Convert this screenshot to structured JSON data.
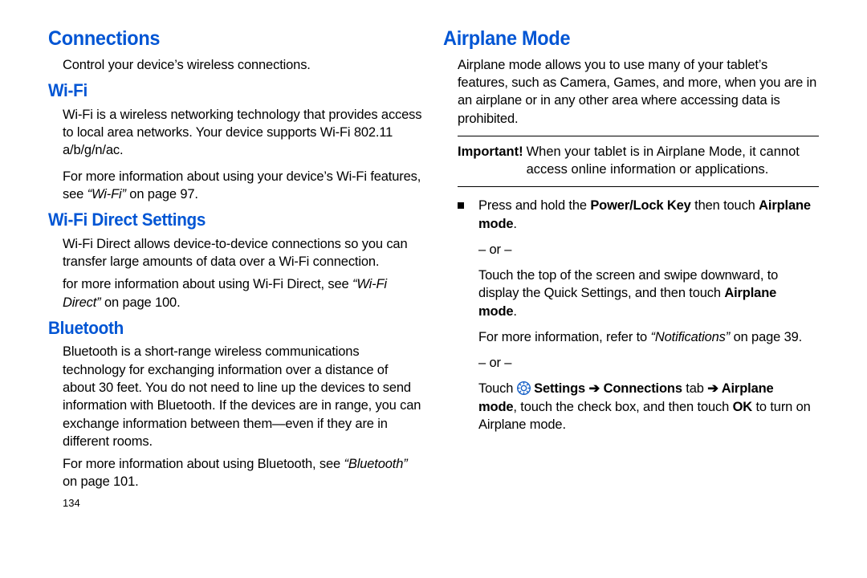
{
  "left": {
    "h1": "Connections",
    "intro": "Control your device’s wireless connections.",
    "wifi_h": "Wi-Fi",
    "wifi_p1a": "Wi-Fi is a wireless networking technology that provides access to local area networks. Your device supports Wi-Fi 802.11 a/b/g/n/ac.",
    "wifi_p2a": "For more information about using your device’s Wi-Fi features, see ",
    "wifi_p2i": "“Wi-Fi”",
    "wifi_p2b": " on page 97.",
    "wfd_h": "Wi-Fi Direct Settings",
    "wfd_p1": "Wi-Fi Direct allows device-to-device connections so you can transfer large amounts of data over a Wi-Fi connection.",
    "wfd_p2a": "for more information about using Wi-Fi Direct, see ",
    "wfd_p2i": "“Wi-Fi Direct”",
    "wfd_p2b": " on page 100.",
    "bt_h": "Bluetooth",
    "bt_p1": "Bluetooth is a short-range wireless communications technology for exchanging information over a distance of about 30 feet. You do not need to line up the devices to send information with Bluetooth. If the devices are in range, you can exchange information between them—even if they are in different rooms.",
    "bt_p2a": "For more information about using Bluetooth, see ",
    "bt_p2i": "“Bluetooth”",
    "bt_p2b": " on page 101.",
    "page_num": "134"
  },
  "right": {
    "h1": "Airplane Mode",
    "p1": "Airplane mode allows you to use many of your tablet’s features, such as Camera, Games, and more, when you are in an airplane or in any other area where accessing data is prohibited.",
    "imp_label": "Important!",
    "imp_text": "When your tablet is in Airplane Mode, it cannot access online information or applications.",
    "b1a": "Press and hold the ",
    "b1b": "Power/Lock Key",
    "b1c": " then touch ",
    "b1d": "Airplane mode",
    "b1e": ".",
    "or": "– or –",
    "b2a": "Touch the top of the screen and swipe downward, to display the Quick Settings, and then touch ",
    "b2b": "Airplane mode",
    "b2c": ".",
    "b3a": "For more information, refer to ",
    "b3i": "“Notifications”",
    "b3b": " on page 39.",
    "b4a": "Touch ",
    "b4set": "Settings",
    "b4arr": " ➔ ",
    "b4conn": "Connections",
    "b4tab": " tab ",
    "b4air": "Airplane mode",
    "b4rest": ", touch the check box, and then touch ",
    "b4ok": "OK",
    "b4end": " to turn on Airplane mode."
  }
}
